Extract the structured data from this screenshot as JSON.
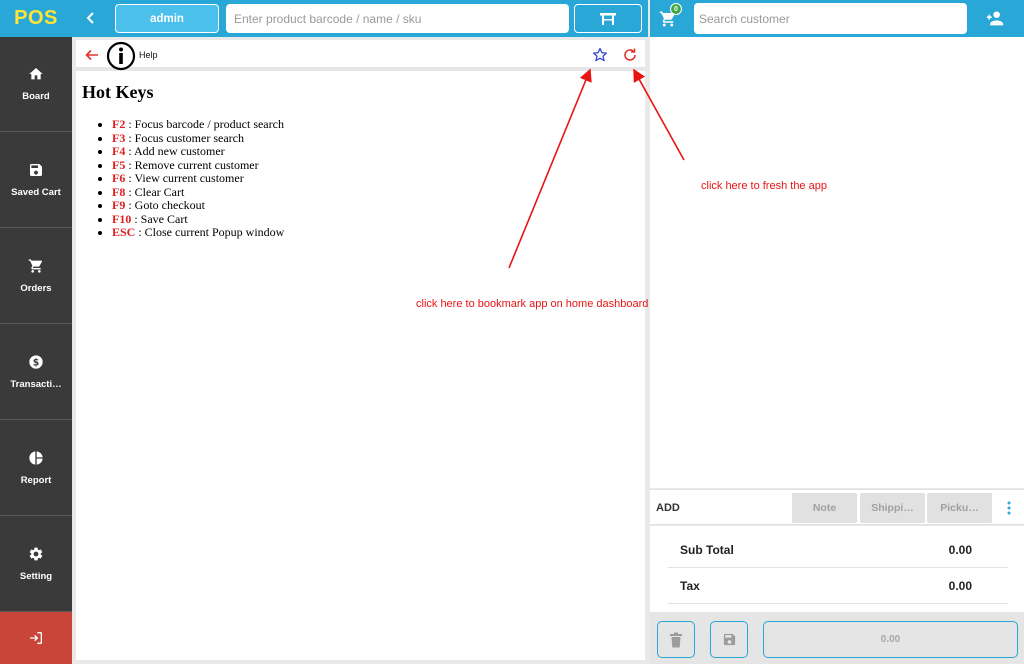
{
  "app": {
    "logo": "POS"
  },
  "sidebar": {
    "items": [
      {
        "label": "Board",
        "icon": "home-icon"
      },
      {
        "label": "Saved Cart",
        "icon": "floppy-icon"
      },
      {
        "label": "Orders",
        "icon": "cart-icon"
      },
      {
        "label": "Transacti…",
        "icon": "dollar-circle-icon"
      },
      {
        "label": "Report",
        "icon": "pie-chart-icon"
      },
      {
        "label": "Setting",
        "icon": "gear-icon"
      }
    ],
    "logout_icon": "logout-icon"
  },
  "header": {
    "user": "admin",
    "barcode_placeholder": "Enter product barcode / name / sku",
    "customer_placeholder": "Search customer",
    "cart_count": "0"
  },
  "help": {
    "toolbar_label": "Help",
    "title": "Hot Keys",
    "hotkeys": [
      {
        "key": "F2",
        "desc": " : Focus barcode / product search"
      },
      {
        "key": "F3",
        "desc": " : Focus customer search"
      },
      {
        "key": "F4",
        "desc": " : Add new customer"
      },
      {
        "key": "F5",
        "desc": " : Remove current customer"
      },
      {
        "key": "F6",
        "desc": " : View current customer"
      },
      {
        "key": "F8",
        "desc": " : Clear Cart"
      },
      {
        "key": "F9",
        "desc": " : Goto checkout"
      },
      {
        "key": "F10",
        "desc": " : Save Cart"
      },
      {
        "key": "ESC",
        "desc": " : Close current Popup window"
      }
    ]
  },
  "annotations": {
    "refresh_note": "click here to fresh the app",
    "bookmark_note": "click here to bookmark app on home dashboard"
  },
  "cart": {
    "add_label": "ADD",
    "note_label": "Note",
    "shipping_label": "Shippi…",
    "pickup_label": "Picku…",
    "subtotal_label": "Sub Total",
    "subtotal_value": "0.00",
    "tax_label": "Tax",
    "tax_value": "0.00",
    "checkout_total": "0.00"
  },
  "colors": {
    "accent": "#29a8d8",
    "sidebar_bg": "#3a3a3a",
    "logout_bg": "#c9453a",
    "logo_text": "#ffe438",
    "annotation": "#e81414"
  }
}
